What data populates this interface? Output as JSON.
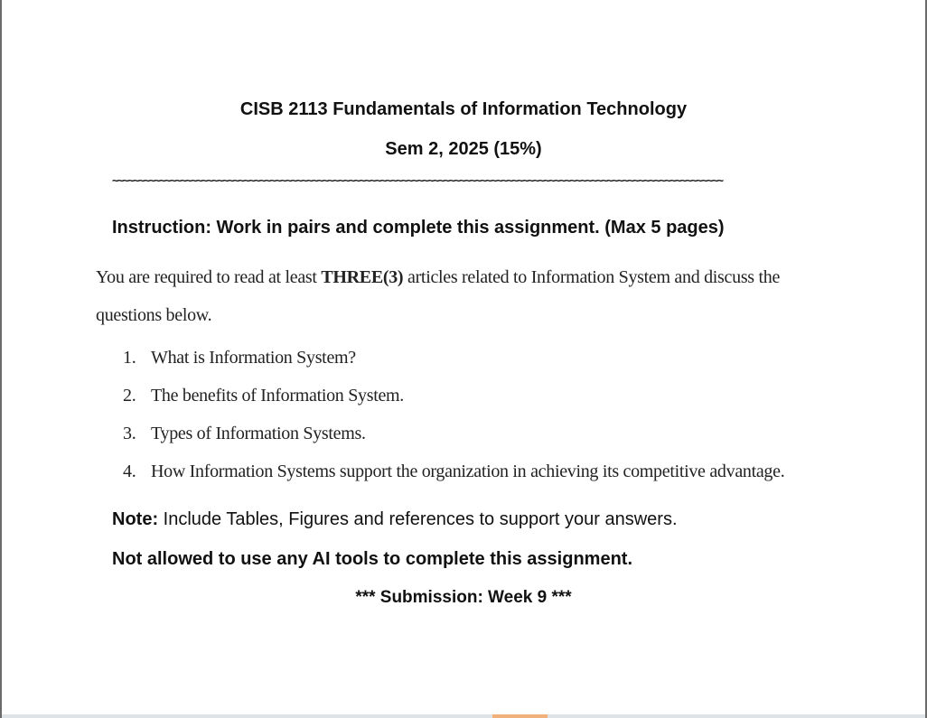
{
  "document": {
    "title": "CISB 2113 Fundamentals of Information Technology",
    "subtitle": "Sem 2, 2025 (15%)",
    "separator": "~~~~~~~~~~~~~~~~~~~~~~~~~~~~~~~~~~~~~~~~~~~~~~~~~~~~~~~~~~~~~~~~~~~~~~~~~~~~~~~~~~~~~~~~~~~~~~~~~~~~~~~~~~~~~~~~~~~~",
    "instruction": "Instruction: Work in pairs and complete this assignment. (Max 5 pages)",
    "intro": {
      "before": "You are required to read at least ",
      "emphasis": "THREE(3)",
      "after": " articles related to Information System and discuss the questions below."
    },
    "questions": [
      {
        "number": "1.",
        "text": "What is Information System?"
      },
      {
        "number": "2.",
        "text": "The benefits of Information System."
      },
      {
        "number": "3.",
        "text": "Types of Information Systems."
      },
      {
        "number": "4.",
        "text": "How Information Systems support the organization in achieving its competitive advantage."
      }
    ],
    "note": {
      "label": "Note:",
      "text": " Include Tables, Figures and references to support your answers."
    },
    "warning": "Not allowed to use any AI tools to complete this assignment.",
    "submission": "*** Submission: Week 9 ***"
  },
  "colors": {
    "text": "#111111",
    "page_border": "#6b6b6b",
    "bottom_bar": "#dde3e7",
    "bottom_accent": "#f0b27a"
  }
}
